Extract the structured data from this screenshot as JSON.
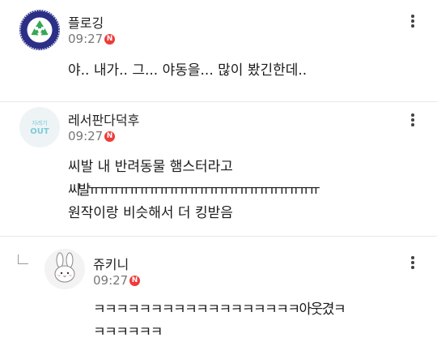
{
  "comments": [
    {
      "author": "플로깅",
      "time": "09:27",
      "new_badge": "N",
      "lines": [
        "야.. 내가.. 그... 야동을... 많이 봤긴한데.."
      ],
      "avatar_icon": "recycle-logo-icon"
    },
    {
      "author": "레서판다덕후",
      "time": "09:27",
      "new_badge": "N",
      "avatar_text": [
        "자레기",
        "OUT"
      ],
      "avatar_icon": "trash-out-logo-icon",
      "lines": [
        "씨발 내 반려동물 햄스터라고",
        "씨발ㅠㅠㅠㅠㅠㅠㅠㅠㅠㅠㅠㅠㅠㅠㅠㅠㅠㅠㅠㅠㅠㅠㅠ",
        "원작이랑 비슷해서 더 킹받음"
      ]
    },
    {
      "author": "쥬키니",
      "time": "09:27",
      "new_badge": "N",
      "avatar_icon": "bunny-avatar-icon",
      "lines": [
        "ㅋㅋㅋㅋㅋㅋㅋㅋㅋㅋㅋㅋㅋㅋㅋㅋㅋㅋ아웃겼ㅋ",
        "ㅋㅋㅋㅋㅋㅋ"
      ]
    }
  ],
  "colors": {
    "badge": "#ee3b3b",
    "divider": "#e8e8e8",
    "avatar_navy": "#2b2f86",
    "avatar_teal": "#7fcbd5"
  }
}
